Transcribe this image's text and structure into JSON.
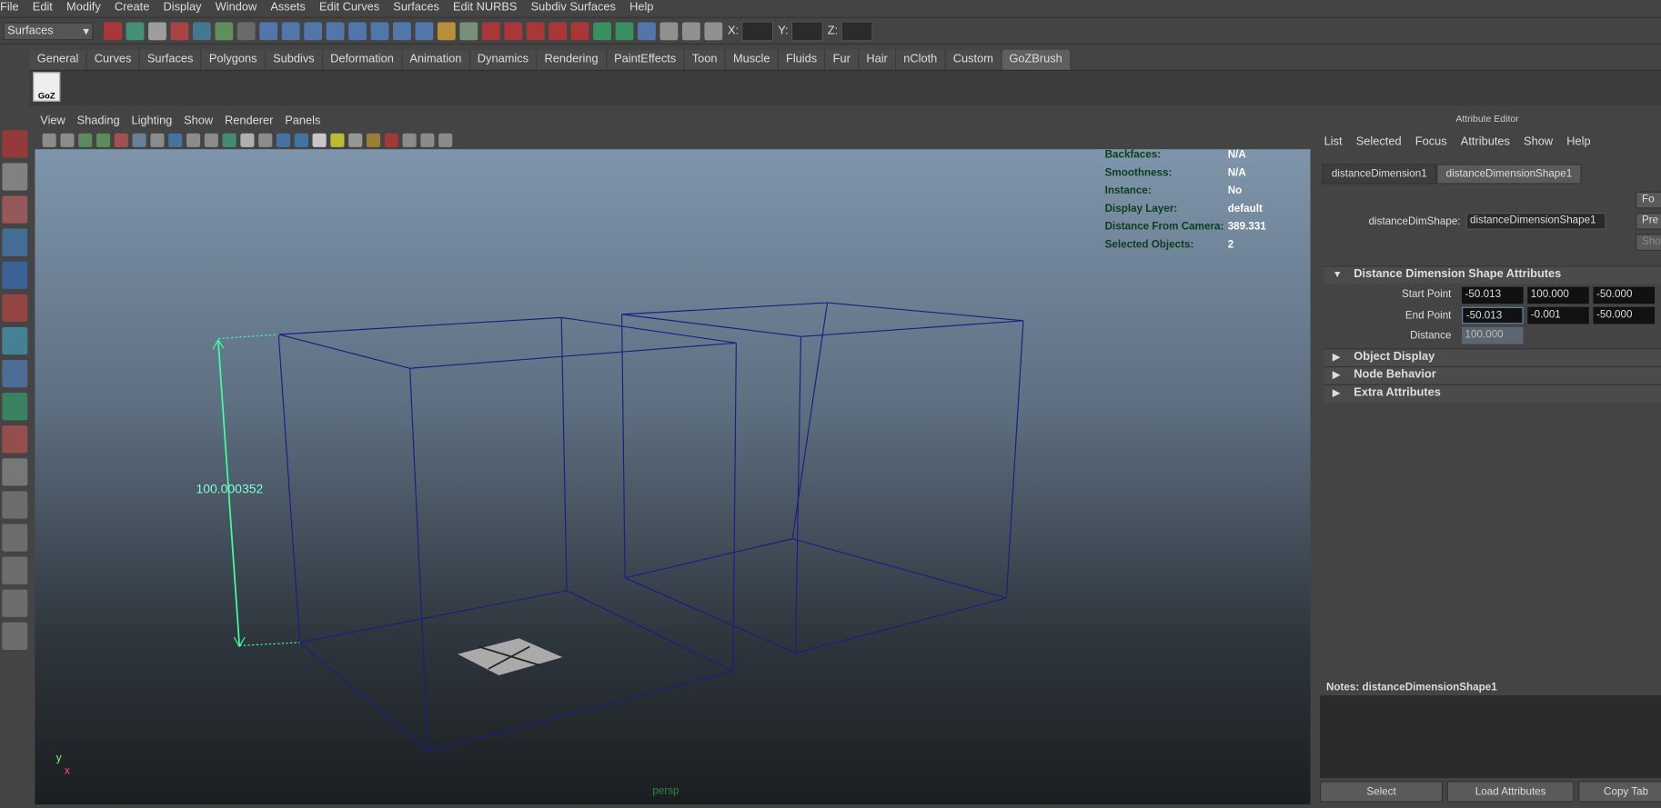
{
  "menubar": [
    "File",
    "Edit",
    "Modify",
    "Create",
    "Display",
    "Window",
    "Assets",
    "Edit Curves",
    "Surfaces",
    "Edit NURBS",
    "Subdiv Surfaces",
    "Help"
  ],
  "toolbar": {
    "mode": "Surfaces",
    "x_label": "X:",
    "y_label": "Y:",
    "z_label": "Z:"
  },
  "shelf_tabs": [
    "General",
    "Curves",
    "Surfaces",
    "Polygons",
    "Subdivs",
    "Deformation",
    "Animation",
    "Dynamics",
    "Rendering",
    "PaintEffects",
    "Toon",
    "Muscle",
    "Fluids",
    "Fur",
    "Hair",
    "nCloth",
    "Custom",
    "GoZBrush"
  ],
  "shelf_active": "GoZBrush",
  "shelf_goz": "GoZ",
  "panel_menu": [
    "View",
    "Shading",
    "Lighting",
    "Show",
    "Renderer",
    "Panels"
  ],
  "hud": [
    {
      "k": "Backfaces:",
      "v": "N/A"
    },
    {
      "k": "Smoothness:",
      "v": "N/A"
    },
    {
      "k": "Instance:",
      "v": "No"
    },
    {
      "k": "Display Layer:",
      "v": "default"
    },
    {
      "k": "Distance From Camera:",
      "v": "389.331"
    },
    {
      "k": "Selected Objects:",
      "v": "2"
    }
  ],
  "viewport": {
    "dimension_label": "100.000352",
    "camera": "persp",
    "axis_y": "y",
    "axis_x": "x",
    "wire_color": "#1a1f80",
    "dim_color": "#3dff9e"
  },
  "attribute_editor": {
    "title": "Attribute Editor",
    "menu": [
      "List",
      "Selected",
      "Focus",
      "Attributes",
      "Show",
      "Help"
    ],
    "tabs": [
      "distanceDimension1",
      "distanceDimensionShape1"
    ],
    "active_tab": "distanceDimensionShape1",
    "node_label": "distanceDimShape:",
    "node_value": "distanceDimensionShape1",
    "right_buttons": [
      "Fo",
      "Pre",
      "Show"
    ],
    "sections": {
      "main": "Distance Dimension Shape Attributes",
      "collapsed": [
        "Object Display",
        "Node Behavior",
        "Extra Attributes"
      ]
    },
    "start_point": {
      "label": "Start Point",
      "values": [
        "-50.013",
        "100.000",
        "-50.000"
      ]
    },
    "end_point": {
      "label": "End Point",
      "values": [
        "-50.013",
        "-0.001",
        "-50.000"
      ]
    },
    "distance": {
      "label": "Distance",
      "value": "100.000"
    },
    "notes": "Notes:  distanceDimensionShape1",
    "buttons": [
      "Select",
      "Load Attributes",
      "Copy Tab"
    ]
  }
}
